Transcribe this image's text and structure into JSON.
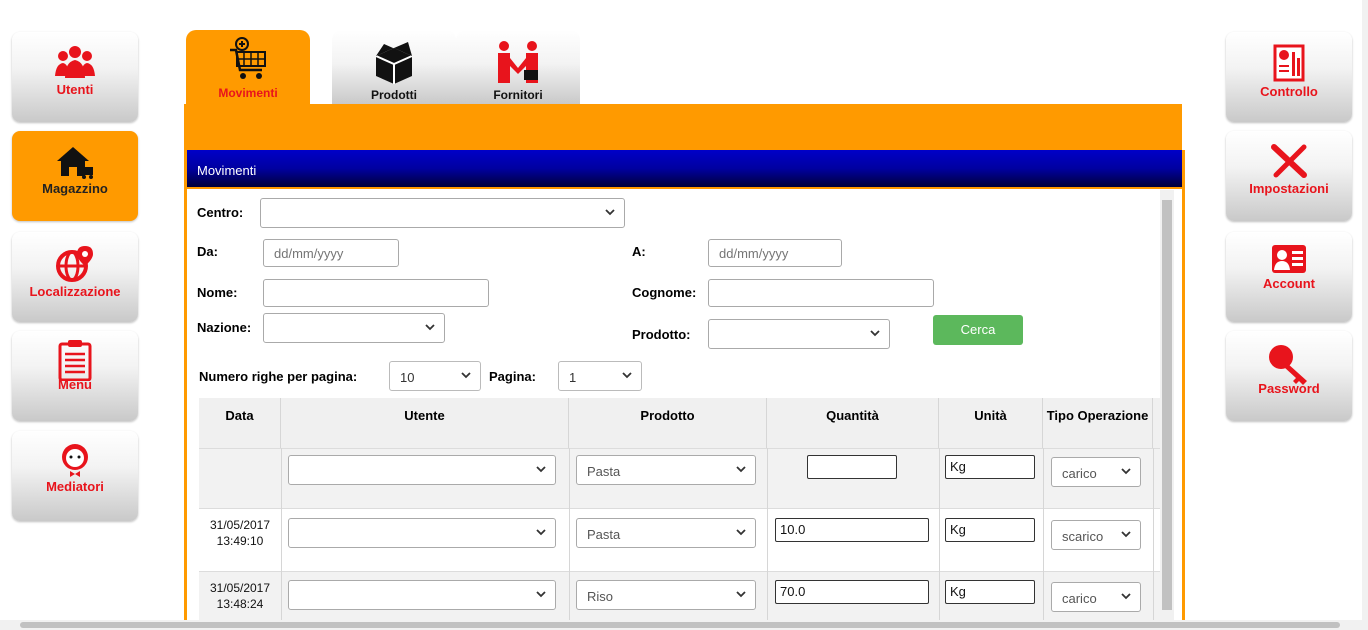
{
  "sidebar_left": [
    {
      "label": "Utenti",
      "icon": "users-icon",
      "active": false
    },
    {
      "label": "Magazzino",
      "icon": "warehouse-icon",
      "active": true
    },
    {
      "label": "Localizzazione",
      "icon": "globe-location-icon",
      "active": false
    },
    {
      "label": "Menu",
      "icon": "clipboard-list-icon",
      "active": false
    },
    {
      "label": "Mediatori",
      "icon": "mediator-person-icon",
      "active": false
    }
  ],
  "sidebar_right": [
    {
      "label": "Controllo",
      "icon": "report-chart-icon"
    },
    {
      "label": "Impostazioni",
      "icon": "tools-icon"
    },
    {
      "label": "Account",
      "icon": "id-card-icon"
    },
    {
      "label": "Password",
      "icon": "key-icon"
    }
  ],
  "tabs": [
    {
      "label": "Movimenti",
      "icon": "cart-icon",
      "active": true
    },
    {
      "label": "Prodotti",
      "icon": "box-icon",
      "active": false
    },
    {
      "label": "Fornitori",
      "icon": "suppliers-icon",
      "active": false
    }
  ],
  "panel": {
    "title": "Movimenti"
  },
  "filters": {
    "centro_label": "Centro:",
    "centro_value": "",
    "da_label": "Da:",
    "da_placeholder": "dd/mm/yyyy",
    "a_label": "A:",
    "a_placeholder": "dd/mm/yyyy",
    "nome_label": "Nome:",
    "nome_value": "",
    "cognome_label": "Cognome:",
    "cognome_value": "",
    "nazione_label": "Nazione:",
    "nazione_value": "",
    "prodotto_label": "Prodotto:",
    "prodotto_value": "",
    "search_button": "Cerca",
    "rows_per_page_label": "Numero righe per pagina:",
    "rows_per_page_value": "10",
    "page_label": "Pagina:",
    "page_value": "1"
  },
  "table": {
    "headers": [
      "Data",
      "Utente",
      "Prodotto",
      "Quantità",
      "Unità",
      "Tipo Operazione"
    ],
    "filter_row": {
      "utente": "",
      "prodotto": "Pasta",
      "quantita": "",
      "unita": "Kg",
      "tipo": "carico"
    },
    "rows": [
      {
        "date": "31/05/2017",
        "time": "13:49:10",
        "utente": "",
        "prodotto": "Pasta",
        "quantita": "10.0",
        "unita": "Kg",
        "tipo": "scarico"
      },
      {
        "date": "31/05/2017",
        "time": "13:48:24",
        "utente": "",
        "prodotto": "Riso",
        "quantita": "70.0",
        "unita": "Kg",
        "tipo": "carico"
      }
    ]
  },
  "colors": {
    "accent": "#ff9a00",
    "header_blue": "#0000a0",
    "button_green": "#5cb85c",
    "label_red": "#e8141c"
  }
}
